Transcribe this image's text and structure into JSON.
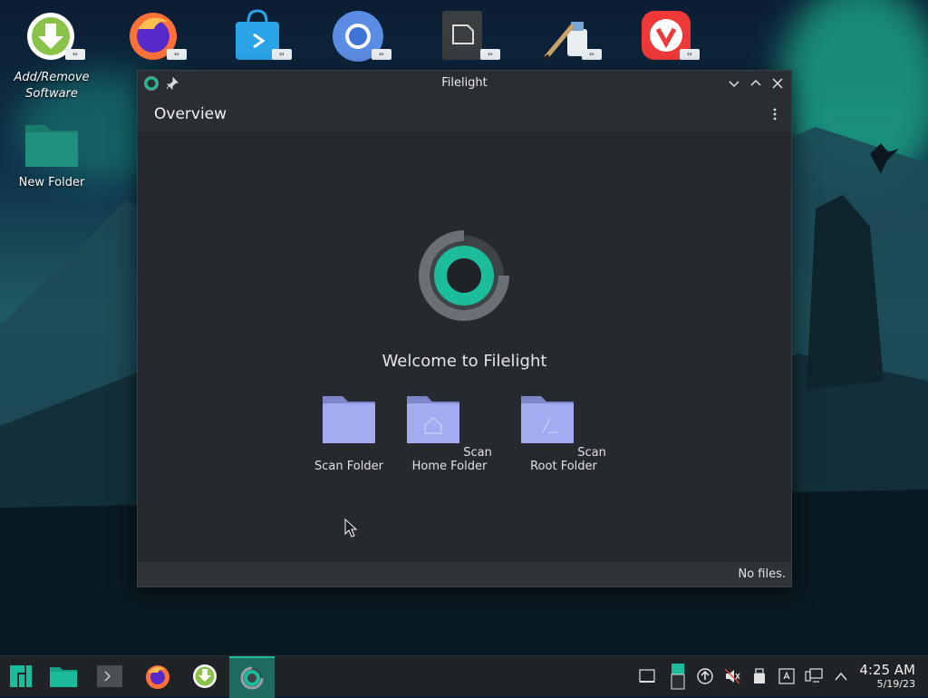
{
  "desktop": {
    "top_icons": [
      "software-center-icon",
      "firefox-icon",
      "store-icon",
      "chromium-icon",
      "document-viewer-icon",
      "paint-icon",
      "vivaldi-icon"
    ],
    "add_remove_label": "Add/Remove Software",
    "new_folder_label": "New Folder"
  },
  "window": {
    "title": "Filelight",
    "header_title": "Overview",
    "welcome": "Welcome to Filelight",
    "actions": [
      {
        "label": "Scan Folder",
        "icon": "folder-icon"
      },
      {
        "label": "Scan Home Folder",
        "icon": "home-folder-icon"
      },
      {
        "label": "Scan Root Folder",
        "icon": "root-folder-icon"
      }
    ],
    "status": "No files."
  },
  "taskbar": {
    "apps": [
      "manjaro-menu-icon",
      "file-manager-icon",
      "terminal-icon",
      "firefox-icon",
      "software-center-icon",
      "filelight-icon"
    ],
    "clock_time": "4:25 AM",
    "clock_date": "5/19/23"
  },
  "colors": {
    "accent": "#1abc9c",
    "window_bg": "#2a2e32",
    "folder": "#a3acf0"
  }
}
